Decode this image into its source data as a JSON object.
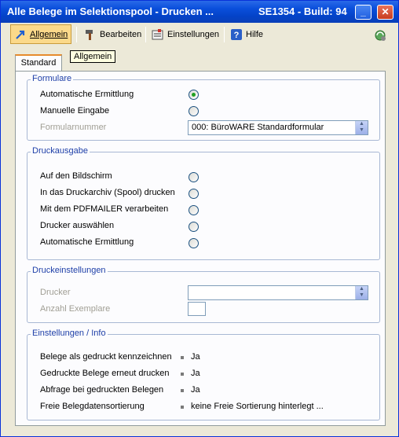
{
  "window": {
    "title": "Alle Belege im Selektionspool - Drucken ...",
    "build": "SE1354 - Build: 94",
    "minimize_glyph": "_",
    "maximize_glyph": "□",
    "close_glyph": "✕"
  },
  "toolbar": {
    "items": [
      {
        "label": "Allgemein",
        "icon": "arrow-icon",
        "active": true
      },
      {
        "label": "Bearbeiten",
        "icon": "hammer-icon"
      },
      {
        "label": "Einstellungen",
        "icon": "settings-icon"
      },
      {
        "label": "Hilfe",
        "icon": "help-icon"
      }
    ],
    "right_icon": "recycle-icon"
  },
  "tooltip": "Allgemein",
  "tabs": [
    {
      "label": "Standard",
      "selected": true
    }
  ],
  "formulare": {
    "title": "Formulare",
    "options": [
      {
        "label": "Automatische Ermittlung",
        "checked": true
      },
      {
        "label": "Manuelle Eingabe",
        "checked": false
      }
    ],
    "formnumber_label": "Formularnummer",
    "formnumber_value": "000: BüroWARE Standardformular"
  },
  "druckausgabe": {
    "title": "Druckausgabe",
    "options": [
      {
        "label": "Auf den Bildschirm",
        "checked": false
      },
      {
        "label": "In das Druckarchiv (Spool) drucken",
        "checked": false
      },
      {
        "label": "Mit dem PDFMAILER verarbeiten",
        "checked": false
      },
      {
        "label": "Drucker auswählen",
        "checked": false
      },
      {
        "label": "Automatische Ermittlung",
        "checked": false
      }
    ]
  },
  "druckeinstellungen": {
    "title": "Druckeinstellungen",
    "drucker_label": "Drucker",
    "drucker_value": "",
    "exemplare_label": "Anzahl Exemplare",
    "exemplare_value": ""
  },
  "info": {
    "title": "Einstellungen / Info",
    "rows": [
      {
        "label": "Belege als gedruckt kennzeichnen",
        "value": "Ja"
      },
      {
        "label": "Gedruckte Belege erneut drucken",
        "value": "Ja"
      },
      {
        "label": "Abfrage bei gedruckten Belegen",
        "value": "Ja"
      },
      {
        "label": "Freie Belegdatensortierung",
        "value": "keine Freie Sortierung hinterlegt ..."
      }
    ]
  },
  "colors": {
    "titlebar": "#0a4fdc",
    "group_title": "#1e3fa8",
    "active_tab": "#e68b2c"
  }
}
